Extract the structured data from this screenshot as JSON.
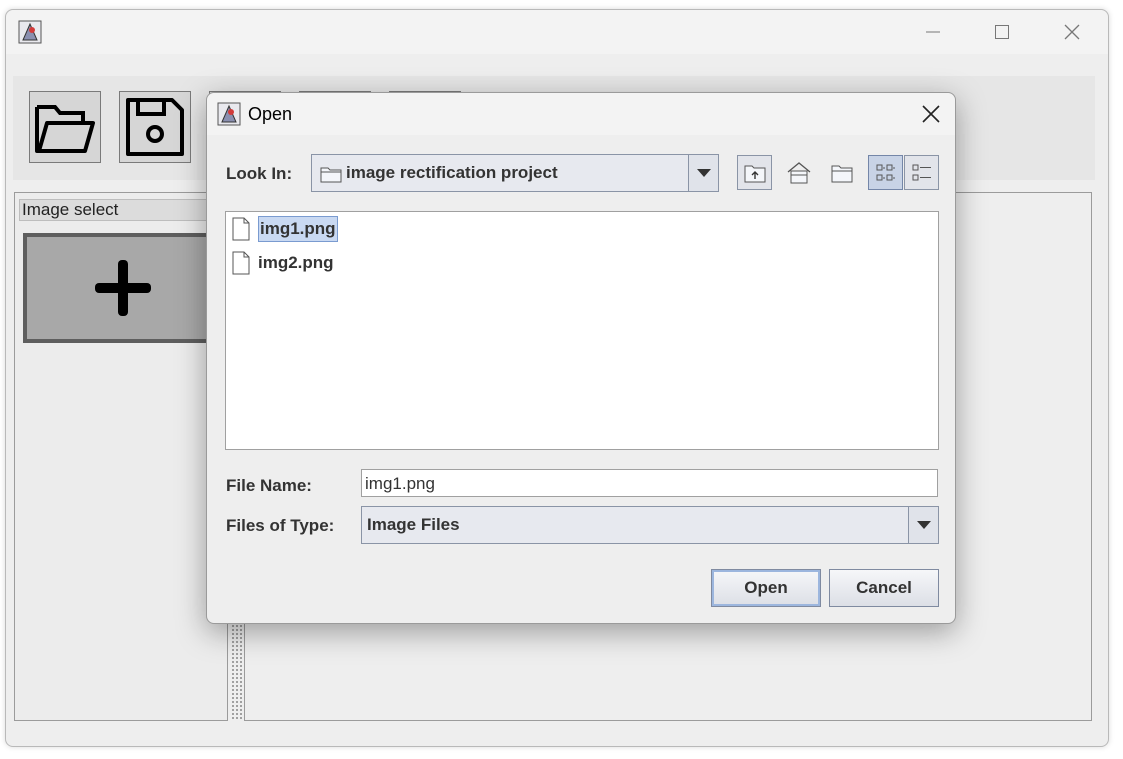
{
  "main_window": {
    "panel_title": "Image select"
  },
  "dialog": {
    "title": "Open",
    "look_in_label": "Look In:",
    "look_in_value": "image rectification project",
    "files": [
      {
        "name": "img1.png",
        "selected": true
      },
      {
        "name": "img2.png",
        "selected": false
      }
    ],
    "file_name_label": "File Name:",
    "file_name_value": "img1.png",
    "files_of_type_label": "Files of Type:",
    "files_of_type_value": "Image Files",
    "open_button": "Open",
    "cancel_button": "Cancel"
  },
  "icons": {
    "app": "java-app-icon",
    "open": "open-folder-icon",
    "save": "save-disk-icon",
    "add": "plus-icon",
    "up": "up-folder-icon",
    "home": "home-icon",
    "new_folder": "new-folder-icon",
    "list_view": "list-view-icon",
    "details_view": "details-view-icon",
    "file": "file-icon"
  },
  "colors": {
    "selection": "#c9d9f2",
    "window_bg": "#eeeeee"
  }
}
